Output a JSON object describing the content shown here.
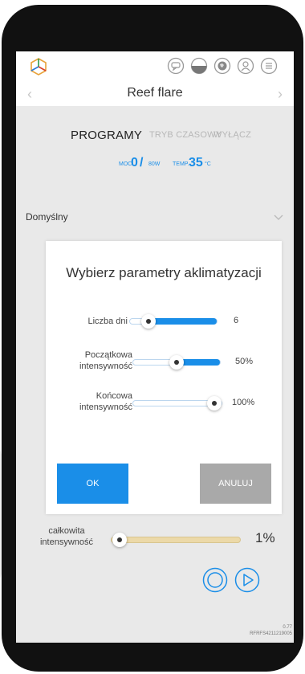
{
  "app": {
    "title": "Reef flare"
  },
  "topbar": {
    "icons": [
      "app-logo-icon",
      "chat-icon",
      "half-circle-icon",
      "globe-icon",
      "user-icon",
      "menu-icon"
    ]
  },
  "tabs": [
    {
      "label": "PROGRAMY",
      "active": true
    },
    {
      "label": "TRYB CZASOWY",
      "active": false
    },
    {
      "label": "WYŁĄCZ",
      "active": false
    }
  ],
  "stats": {
    "power_label": "MOC",
    "power_value": "0",
    "power_slash": "/",
    "power_max": "80W",
    "temp_label": "TEMP.",
    "temp_value": "35",
    "temp_unit": "°C"
  },
  "dropdown": {
    "selected": "Domyślny"
  },
  "dialog": {
    "title": "Wybierz parametry aklimatyzacji",
    "rows": [
      {
        "label": "Liczba dni",
        "value": "6",
        "level": 0.15
      },
      {
        "label": "Początkowa intensywność",
        "value": "50%",
        "level": 0.5
      },
      {
        "label": "Końcowa intensywność",
        "value": "100%",
        "level": 1.0
      }
    ],
    "ok_label": "OK",
    "cancel_label": "ANULUJ"
  },
  "total": {
    "label": "całkowita intensywność",
    "value": "1%",
    "level": 0.01
  },
  "footer": {
    "version": "0.77",
    "serial": "RFRFS4211219005"
  },
  "colors": {
    "accent": "#1a8ee8",
    "cancel": "#a9a9a9",
    "total_track": "#ecd9a8"
  }
}
